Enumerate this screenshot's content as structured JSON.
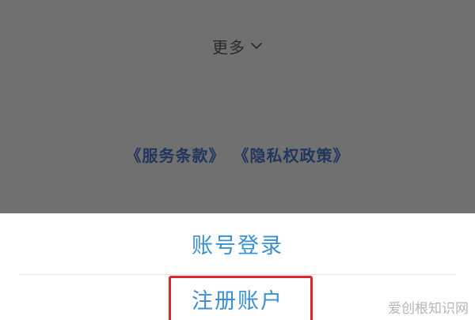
{
  "overlay": {
    "more_label": "更多",
    "more_icon": "chevron-down-icon",
    "terms_link": "《服务条款》",
    "privacy_link": "《隐私权政策》"
  },
  "action_sheet": {
    "login_label": "账号登录",
    "register_label": "注册账户",
    "option_color": "#3a8fd0"
  },
  "annotation": {
    "highlight_color": "#e0262b"
  },
  "watermark": {
    "text": "爱创根知识网"
  }
}
